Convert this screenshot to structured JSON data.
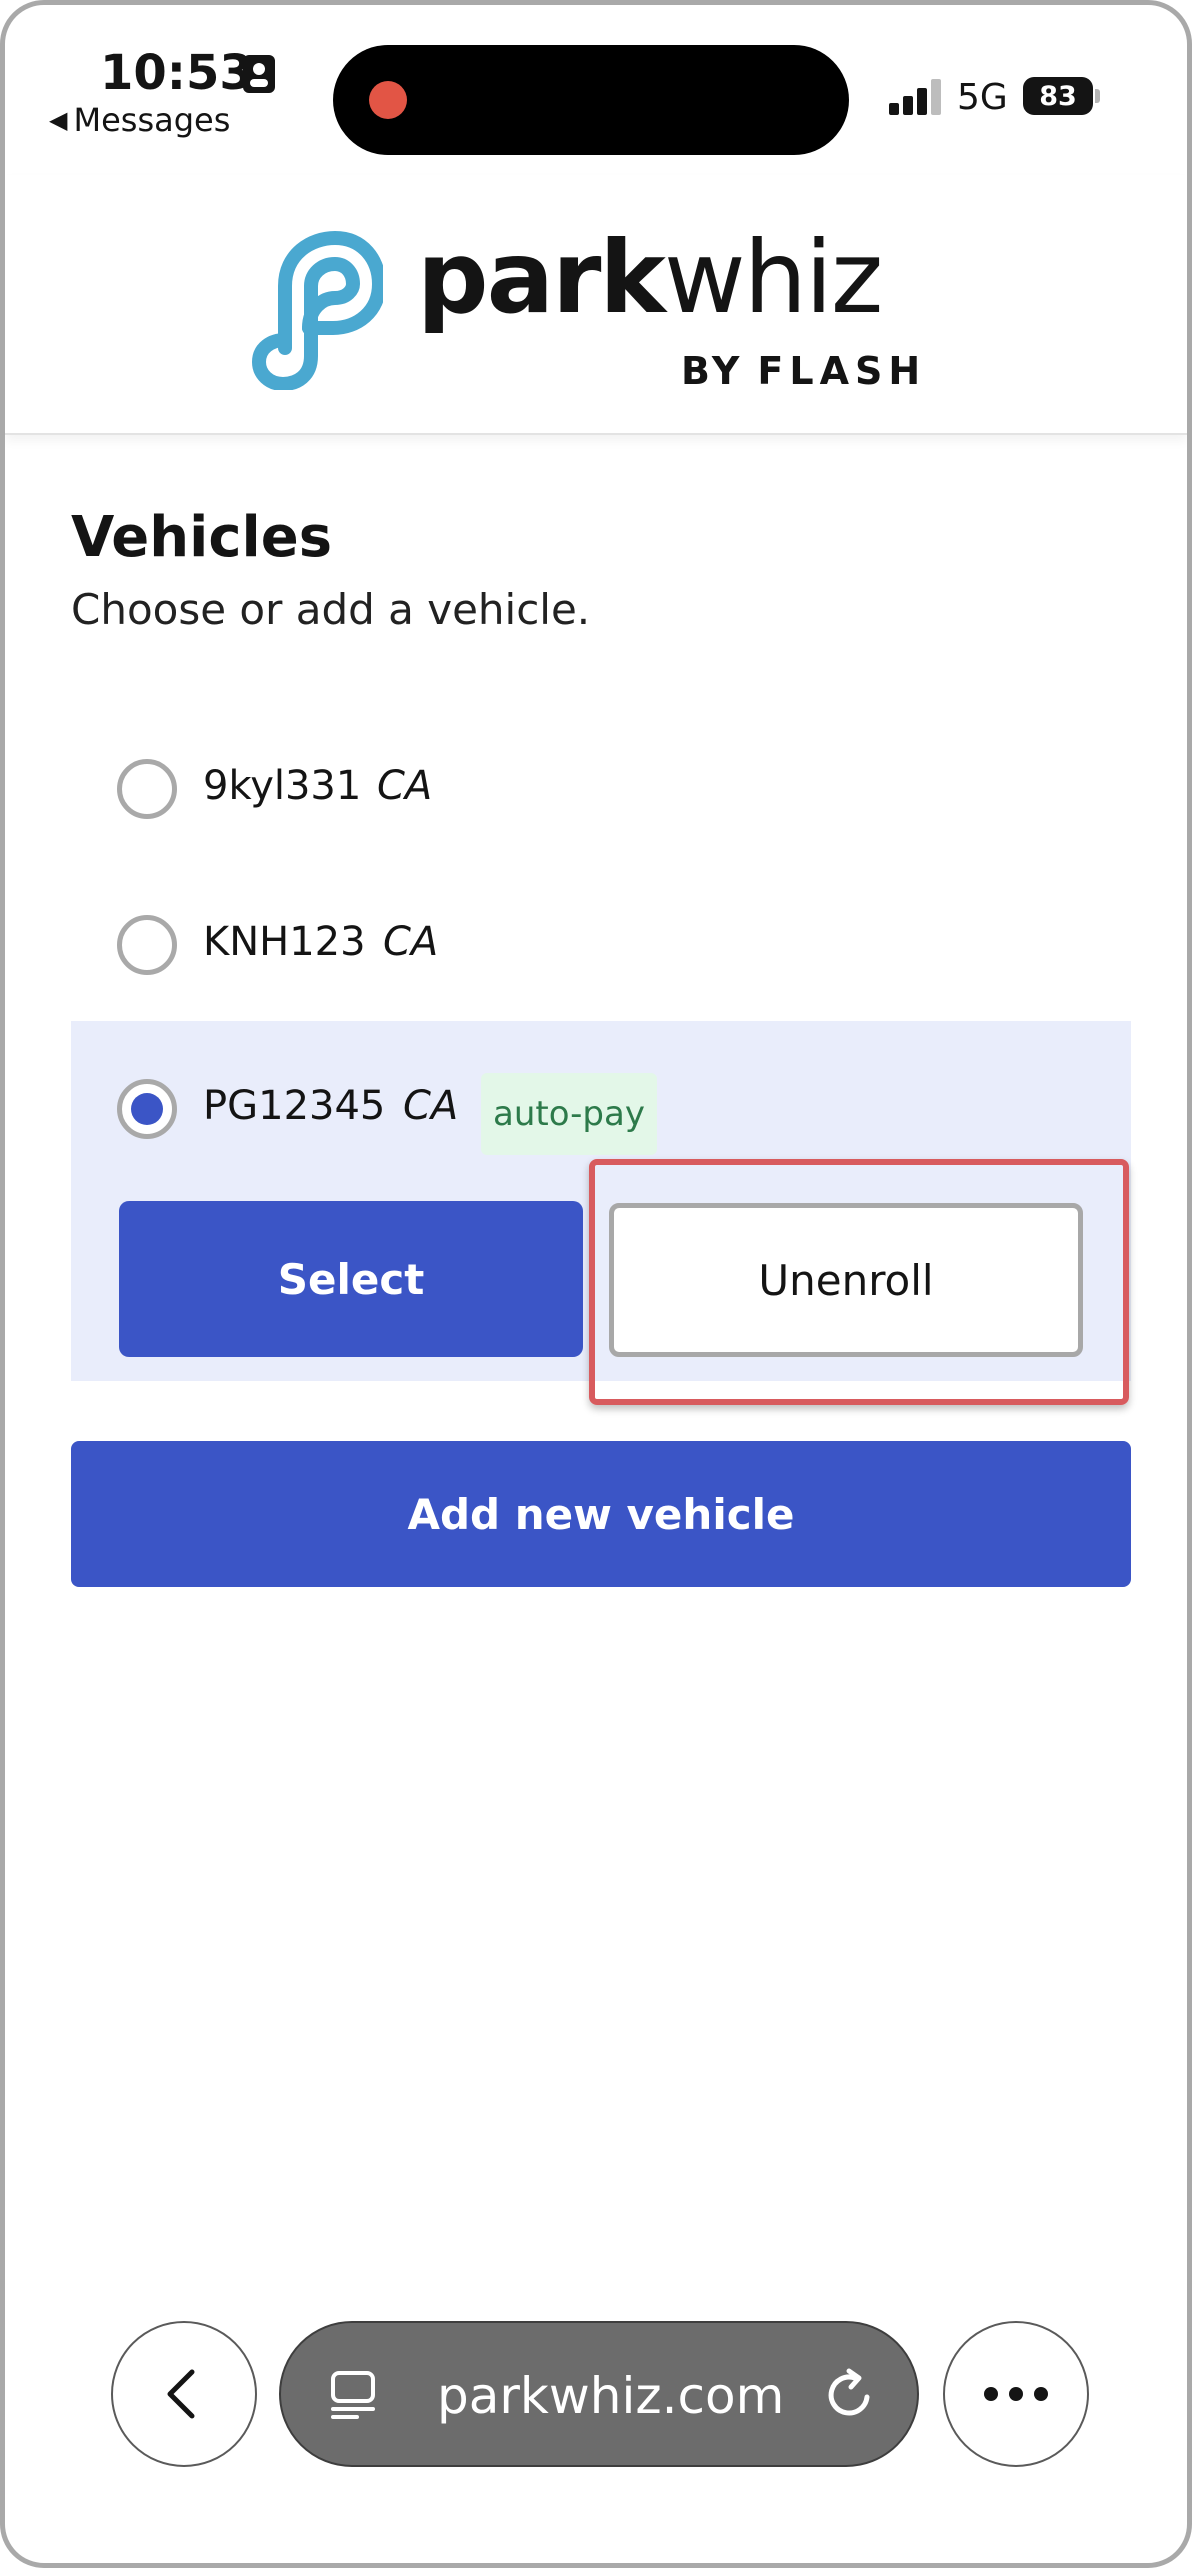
{
  "status_bar": {
    "time": "10:53",
    "back_app_label": "Messages",
    "network": "5G",
    "battery": "83"
  },
  "logo": {
    "word_bold": "park",
    "word_light": "whiz",
    "sub_by": "BY",
    "sub_brand": "FLASH",
    "mark_color": "#4aa8d0"
  },
  "main": {
    "title": "Vehicles",
    "subtitle": "Choose or add a vehicle.",
    "vehicles": [
      {
        "plate": "9kyl331",
        "state": "CA",
        "selected": false
      },
      {
        "plate": "KNH123",
        "state": "CA",
        "selected": false
      },
      {
        "plate": "PG12345",
        "state": "CA",
        "selected": true,
        "badge": "auto-pay"
      }
    ],
    "select_label": "Select",
    "unenroll_label": "Unenroll",
    "add_label": "Add new vehicle"
  },
  "browser": {
    "url": "parkwhiz.com"
  },
  "colors": {
    "accent": "#3b55c6",
    "selected_row_bg": "#e9edfb",
    "badge_bg": "#e3f7e8",
    "badge_text": "#2d7a4a",
    "highlight": "#d85b5e"
  }
}
